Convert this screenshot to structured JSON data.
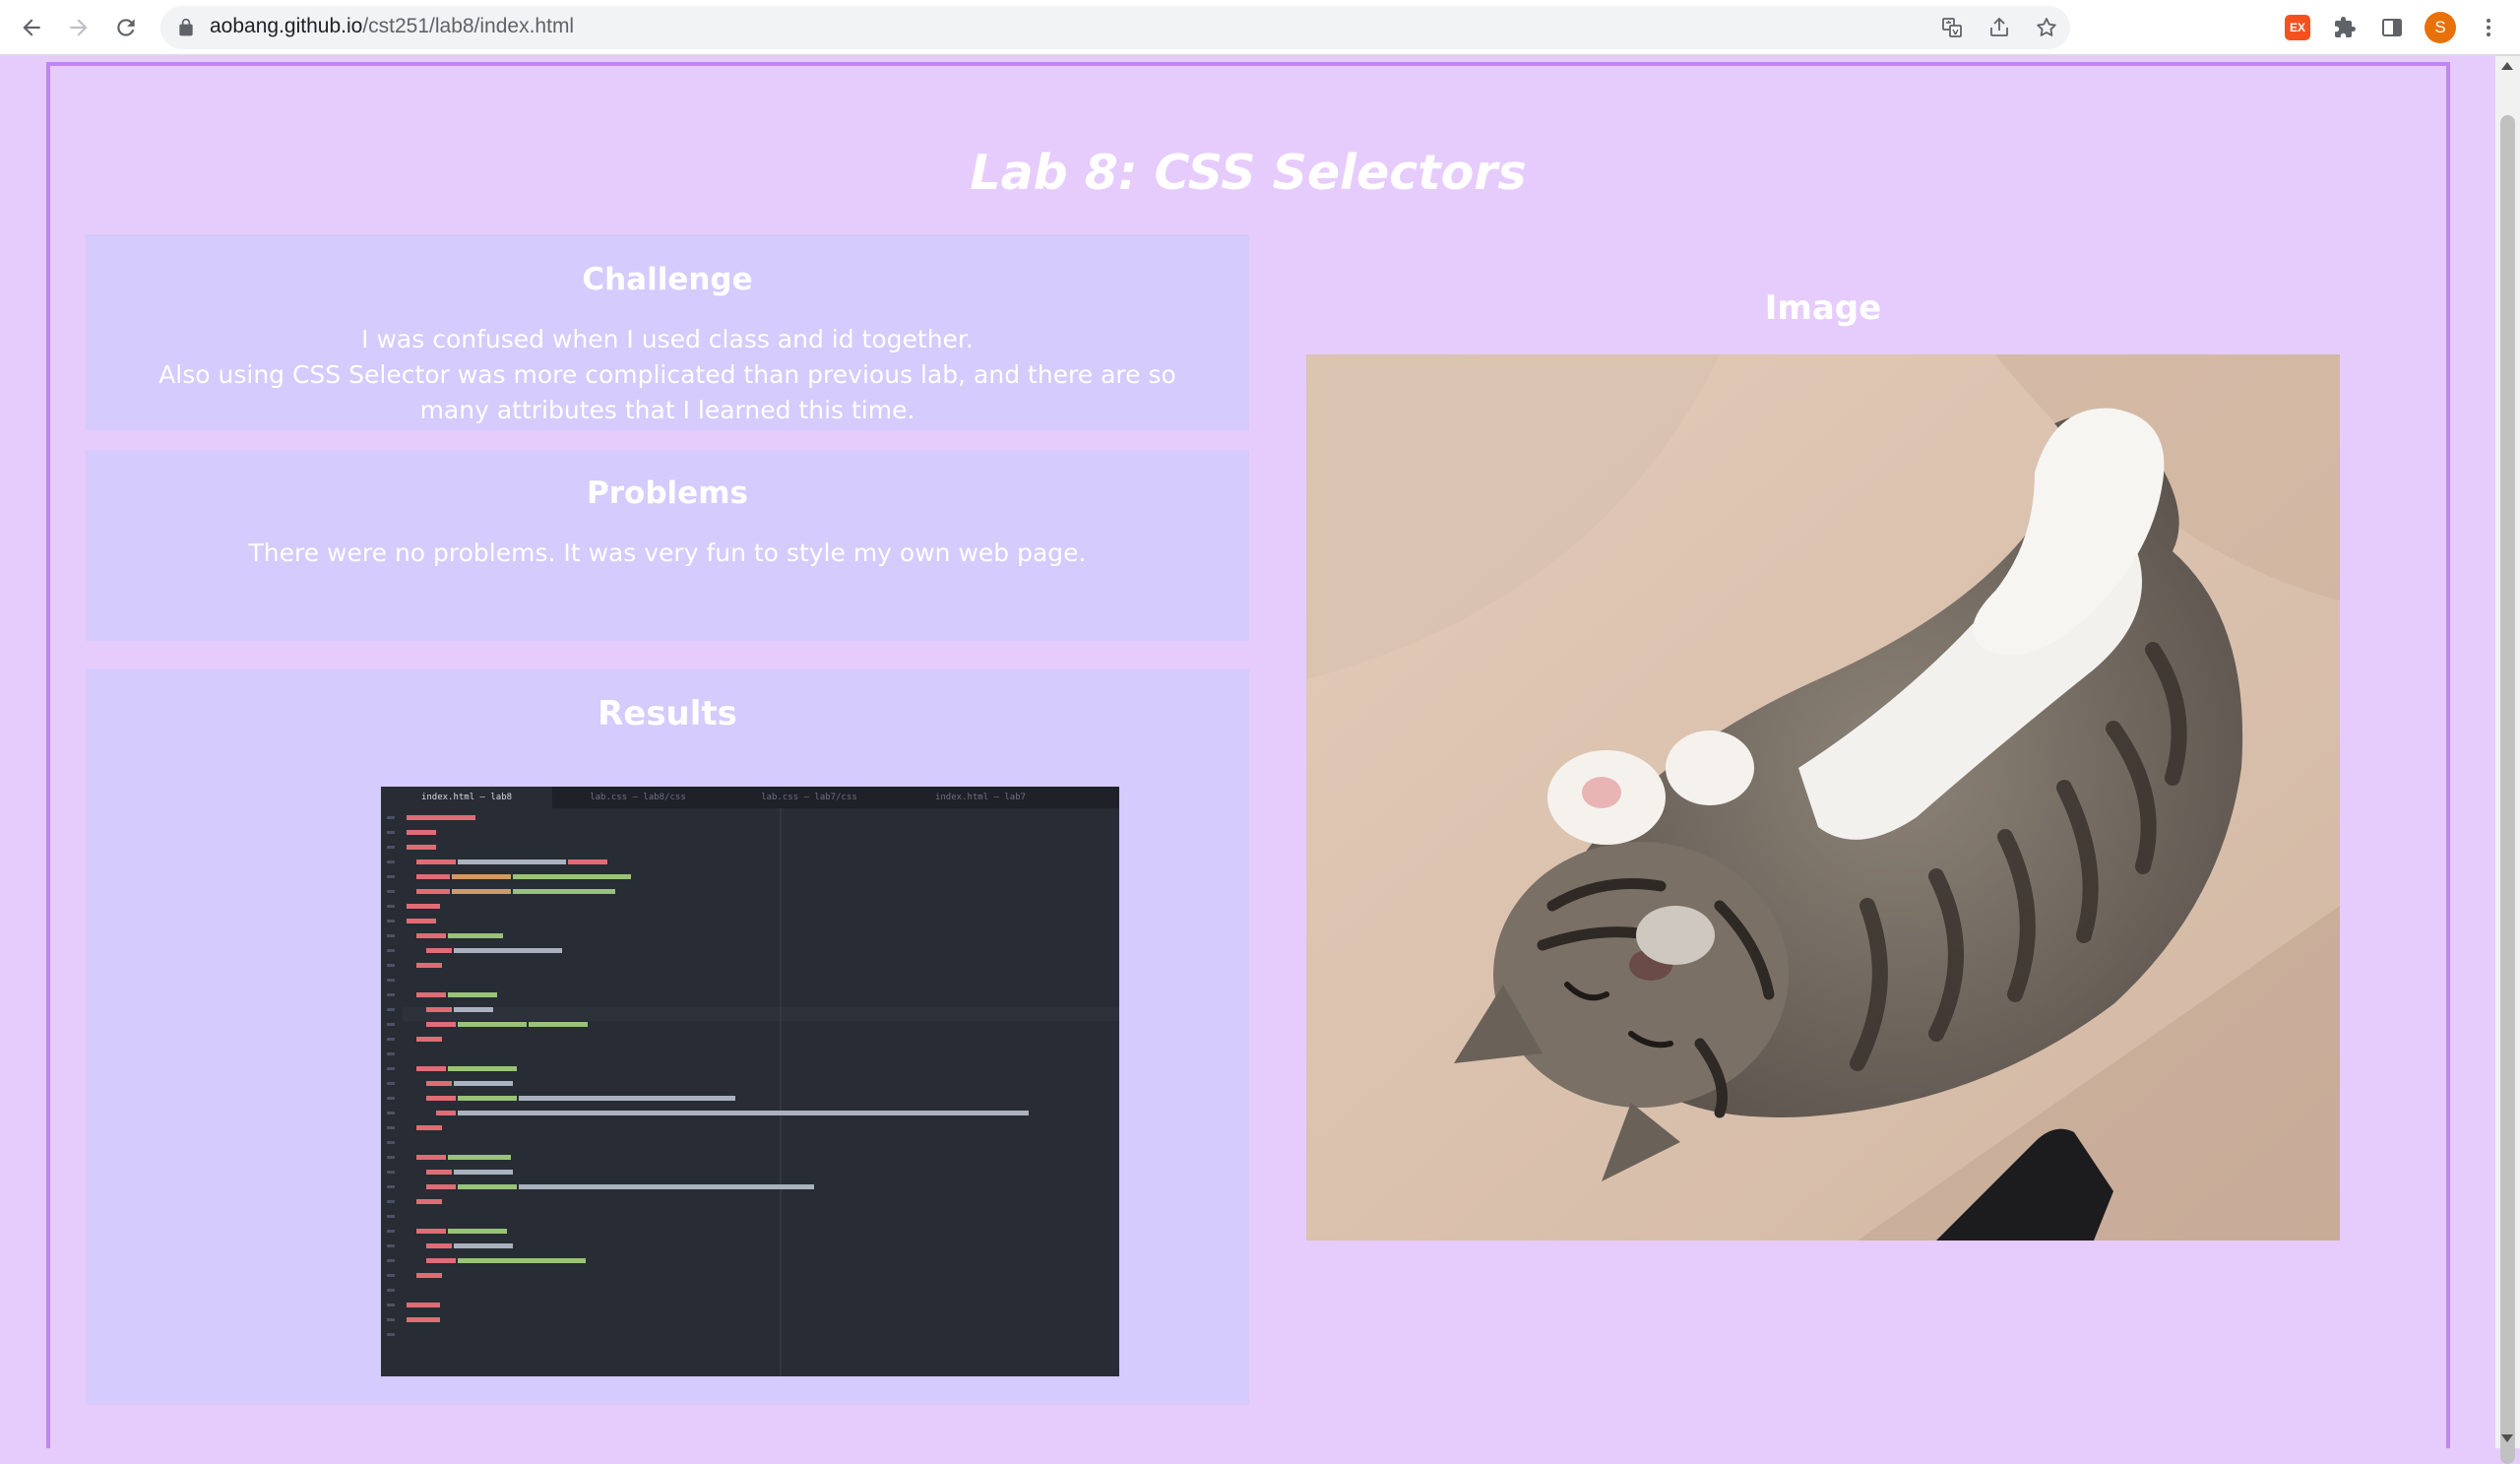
{
  "browser": {
    "url_host": "aobang.github.io",
    "url_path": "/cst251/lab8/index.html",
    "extension_badge": "EX",
    "profile_initial": "S"
  },
  "page": {
    "title": "Lab 8: CSS Selectors",
    "challenge": {
      "heading": "Challenge",
      "line1": "I was confused when I used class and id together.",
      "line2": "Also using CSS Selector was more complicated than previous lab, and there are so many attributes that I learned this time."
    },
    "problems": {
      "heading": "Problems",
      "text": "There were no problems. It was very fun to style my own web page."
    },
    "results": {
      "heading": "Results",
      "editor_tabs": [
        "index.html — lab8",
        "lab.css — lab8/css",
        "lab.css — lab7/css",
        "index.html — lab7"
      ]
    },
    "image_section": {
      "heading": "Image",
      "photo_alt": "sleeping tabby kitten"
    }
  },
  "colors": {
    "page_bg": "#e6ccfc",
    "border": "#bf86f4",
    "card_bg": "#d5cbfc",
    "text": "#ffffff"
  }
}
